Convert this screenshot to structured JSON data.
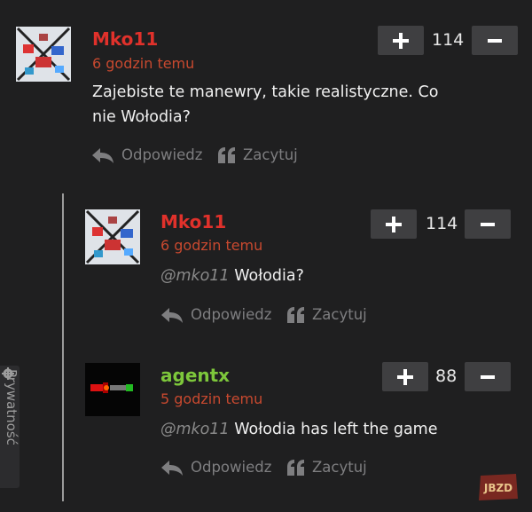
{
  "colors": {
    "background": "#1f1f20",
    "username_red": "#e0312b",
    "username_green": "#7dc73b",
    "timestamp": "#c8492f",
    "vote_button": "#3f3f41",
    "action_text": "#7e7e80"
  },
  "actions": {
    "reply_label": "Odpowiedz",
    "reply_icon": "reply-arrow-icon",
    "quote_label": "Zacytuj",
    "quote_icon": "quote-icon"
  },
  "comments": [
    {
      "username": "Mko11",
      "timestamp": "6 godzin temu",
      "text": "Zajebiste te manewry, takie realistyczne. Co nie Wołodia?",
      "mention": "",
      "votes": "114"
    },
    {
      "username": "Mko11",
      "timestamp": "6 godzin temu",
      "mention": "@mko11",
      "text": "Wołodia?",
      "votes": "114"
    },
    {
      "username": "agentx",
      "timestamp": "5 godzin temu",
      "mention": "@mko11",
      "text": "Wołodia has left the game",
      "votes": "88"
    }
  ],
  "privacy_tab": {
    "label": "Prywatność",
    "icon": "gear-icon"
  },
  "logo": {
    "text": "JBZD"
  }
}
